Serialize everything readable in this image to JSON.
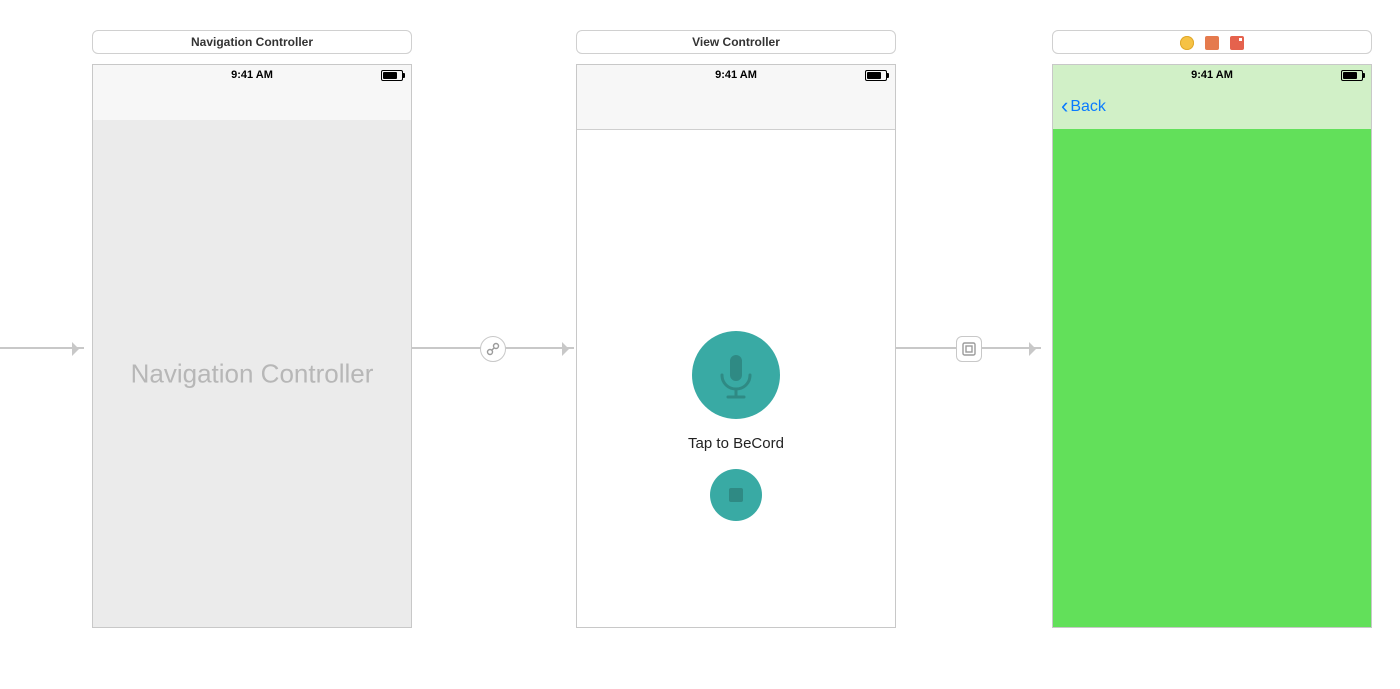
{
  "status_time": "9:41 AM",
  "scenes": {
    "nav": {
      "title": "Navigation Controller",
      "placeholder_text": "Navigation Controller"
    },
    "view": {
      "title": "View Controller",
      "record_label": "Tap to BeCord"
    },
    "green": {
      "back_label": "Back"
    }
  },
  "segues": {
    "initial": {
      "type": "initial"
    },
    "root": {
      "type": "relationship",
      "icon": "link"
    },
    "show": {
      "type": "show",
      "icon": "embed"
    }
  },
  "colors": {
    "teal": "#39aaa4",
    "green_body": "#62e05a",
    "green_nav": "#d1f0c7",
    "ios_blue": "#0a7bff"
  }
}
